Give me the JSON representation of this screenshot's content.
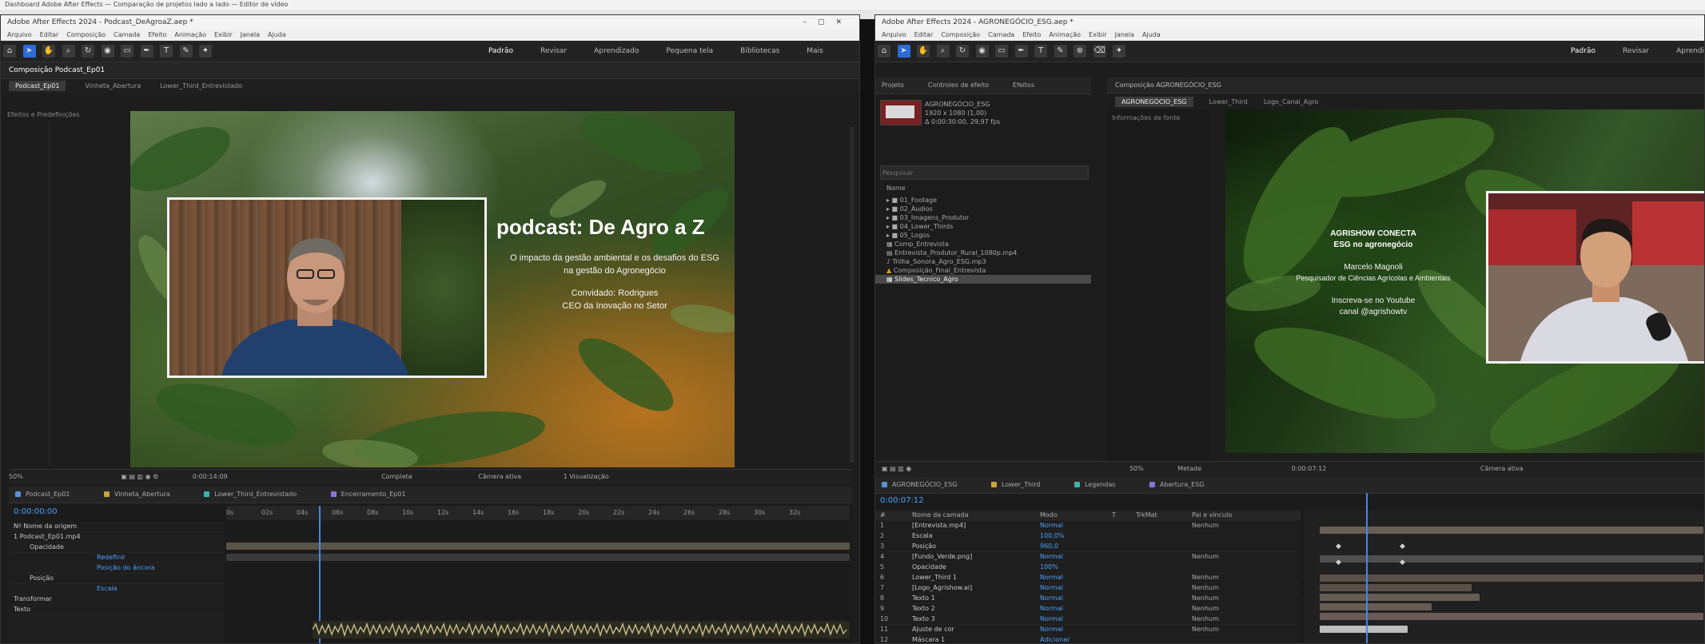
{
  "top_strip": "Dashboard Adobe After Effects — Comparação de projetos lado a lado — Editor de vídeo",
  "left": {
    "title": "Adobe After Effects 2024 - Podcast_DeAgroaZ.aep *",
    "menu": [
      "Arquivo",
      "Editar",
      "Composição",
      "Camada",
      "Efeito",
      "Animação",
      "Exibir",
      "Janela",
      "Ajuda"
    ],
    "workspaces": [
      "Padrão",
      "Revisar",
      "Aprendizado",
      "Pequena tela",
      "Bibliotecas",
      "Mais"
    ],
    "workspace_selected": "Padrão",
    "panel_title": "Composição Podcast_Ep01",
    "comp_tabs": [
      "Podcast_Ep01",
      "Vinheta_Abertura",
      "Lower_Third_Entrevistado"
    ],
    "viewer_side_label": "Efeitos e Predefinições",
    "overlay": {
      "title": "podcast: De Agro a Z",
      "line1": "O impacto da gestão ambiental e os desafios do ESG",
      "line2": "na gestão do Agronegócio",
      "line3": "Convidado: Rodrigues",
      "line4": "CEO da Inovação no Setor"
    },
    "viewer_controls": {
      "zoom": "50%",
      "quality": "Completa",
      "timecode": "0:00:14:09",
      "camera": "Câmera ativa",
      "views": "1 Visualização"
    },
    "timeline_tabs": [
      "Podcast_Ep01",
      "Vinheta_Abertura",
      "Lower_Third_Entrevistado",
      "Encerramento_Ep01"
    ],
    "timeline_tab_colors": [
      "#5b8fd6",
      "#c9a53a",
      "#3bb3a8",
      "#8a74d6"
    ],
    "ruler": [
      "0s",
      "02s",
      "04s",
      "06s",
      "08s",
      "10s",
      "12s",
      "14s",
      "16s",
      "18s",
      "20s",
      "22s",
      "24s",
      "26s",
      "28s",
      "30s",
      "32s"
    ],
    "timecode": "0:00:00:00",
    "layers": [
      "Nº  Nome da origem",
      "1  Podcast_Ep01.mp4",
      "Opacidade",
      "Posição",
      "Transformar",
      "Texto"
    ],
    "layer_props": [
      "Redefinir",
      "Posição do âncora",
      "Escala"
    ]
  },
  "right": {
    "title": "Adobe After Effects 2024 - AGRONEGÓCIO_ESG.aep *",
    "menu": [
      "Arquivo",
      "Editar",
      "Composição",
      "Camada",
      "Efeito",
      "Animação",
      "Exibir",
      "Janela",
      "Ajuda"
    ],
    "workspaces": [
      "Padrão",
      "Revisar",
      "Aprendizado"
    ],
    "workspace_selected": "Padrão",
    "project_tabs": [
      "Projeto",
      "Controles de efeito",
      "Efeitos"
    ],
    "project_meta": [
      "AGRONEGÓCIO_ESG",
      "1920 x 1080 (1,00)",
      "Δ 0:00:30:00, 29,97 fps"
    ],
    "project_search_placeholder": "Pesquisar",
    "project_col": "Nome",
    "project_items": [
      "01_Footage",
      "02_Áudios",
      "03_Imagens_Produtor",
      "04_Lower_Thirds",
      "05_Logos",
      "Comp_Entrevista",
      "Entrevista_Produtor_Rural_1080p.mp4",
      "Trilha_Sonora_Agro_ESG.mp3",
      "Composição_Final_Entrevista",
      "Slides_Tecnico_Agro"
    ],
    "project_selected_index": 9,
    "panel_title": "Composição AGRONEGÓCIO_ESG",
    "comp_tabs": [
      "AGRONEGÓCIO_ESG",
      "Lower_Third",
      "Logo_Canal_Agro"
    ],
    "viewer_side_label": "Informações de fonte",
    "overlay": {
      "title1": "AGRISHOW CONECTA",
      "title2": "ESG no agronegócio",
      "line1": "Marcelo Magnoli",
      "line2": "Pesquisador de Ciências Agrícolas e Ambientais",
      "line3": "Inscreva-se no Youtube",
      "line4": "canal @agrishowtv"
    },
    "viewer_controls": {
      "zoom": "50%",
      "quality": "Metade",
      "timecode": "0:00:07:12",
      "camera": "Câmera ativa"
    },
    "timeline_tabs": [
      "AGRONEGÓCIO_ESG",
      "Lower_Third",
      "Legendas",
      "Abertura_ESG"
    ],
    "timeline_tab_colors": [
      "#5b8fd6",
      "#c9a53a",
      "#3bb3a8",
      "#8a74d6"
    ],
    "timecode": "0:00:07:12",
    "layer_header": [
      "#",
      "Nome da camada",
      "Modo",
      "T",
      "TrkMat",
      "Pai e vínculo"
    ],
    "layers": [
      {
        "name": "[Entrevista.mp4]",
        "mode": "Normal",
        "parent": "Nenhum"
      },
      {
        "name": "Escala",
        "mode": "100,0%",
        "parent": ""
      },
      {
        "name": "Posição",
        "mode": "960,0",
        "parent": ""
      },
      {
        "name": "[Fundo_Verde.png]",
        "mode": "Normal",
        "parent": "Nenhum"
      },
      {
        "name": "Opacidade",
        "mode": "100%",
        "parent": ""
      },
      {
        "name": "Lower_Third 1",
        "mode": "Normal",
        "parent": "Nenhum"
      },
      {
        "name": "[Logo_Agrishow.ai]",
        "mode": "Normal",
        "parent": "Nenhum"
      },
      {
        "name": "Texto 1",
        "mode": "Normal",
        "parent": "Nenhum"
      },
      {
        "name": "Texto 2",
        "mode": "Normal",
        "parent": "Nenhum"
      },
      {
        "name": "Texto 3",
        "mode": "Normal",
        "parent": "Nenhum"
      },
      {
        "name": "Ajuste de cor",
        "mode": "Normal",
        "parent": "Nenhum"
      },
      {
        "name": "Máscara 1",
        "mode": "Adicionar",
        "parent": ""
      }
    ]
  }
}
